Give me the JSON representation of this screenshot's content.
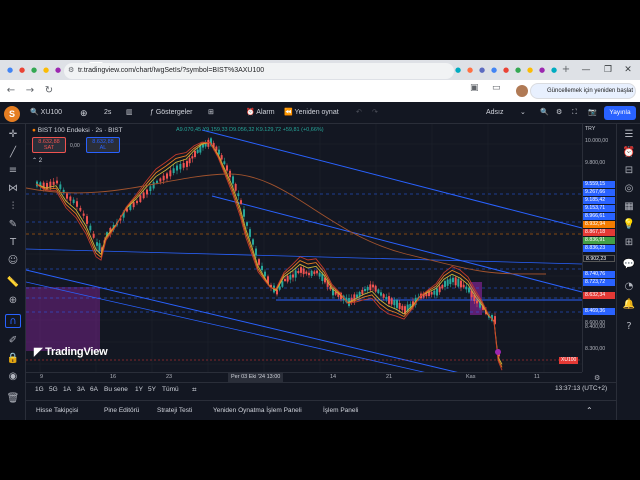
{
  "browser": {
    "tab_icons": [
      "●",
      "●",
      "●",
      "●",
      "●",
      "●",
      "●",
      "×",
      "●",
      "●",
      "●",
      "●",
      "●",
      "●",
      "●",
      "●",
      "●",
      "●",
      "●",
      "●",
      "●",
      "●",
      "●",
      "●",
      "●",
      "●",
      "●",
      "●",
      "●",
      "●",
      "●",
      "●",
      "●",
      "●",
      "●",
      "●",
      "●",
      "●",
      "●",
      "●",
      "●",
      "●",
      "●",
      "●",
      "●",
      "●"
    ],
    "new_tab": "+",
    "minimize": "—",
    "maximize": "❐",
    "close": "✕",
    "url": "tr.tradingview.com/chart/IwgSetIs/?symbol=BIST%3AXU100",
    "relaunch_label": "Güncellemek için yeniden başlat"
  },
  "header": {
    "symbol": "XU100",
    "interval": "2s",
    "indicators": "Göstergeler",
    "alarm": "Alarm",
    "replay": "Yeniden oynat",
    "untitled": "Adsız",
    "publish": "Yayınla",
    "logo_letter": "S"
  },
  "legend": {
    "title": "BIST 100 Endeksi · 2s · BIST",
    "ohlc": "A9.070,45  Y9.159,33  D9.056,32  K9.129,72  +59,81 (+0,66%)",
    "sell_price": "8.632,88",
    "sell_label": "SAT",
    "spread": "0,00",
    "buy_price": "8.632,88",
    "buy_label": "AL",
    "indicator_count": "2",
    "currency": "TRY",
    "watermark": "TradingView"
  },
  "price_scale": {
    "labels": [
      "10.000,00",
      "9.800,00",
      "9.600,00",
      "8.600,00",
      "8.400,00",
      "8.300,00"
    ],
    "boxes": [
      {
        "text": "9.559,15",
        "color": "#2962ff"
      },
      {
        "text": "9.267,66",
        "color": "#2962ff"
      },
      {
        "text": "9.185,42",
        "color": "#2962ff"
      },
      {
        "text": "9.153,71",
        "color": "#2962ff"
      },
      {
        "text": "8.966,61",
        "color": "#2962ff"
      },
      {
        "text": "8.932,94",
        "color": "#f57c00"
      },
      {
        "text": "8.867,18",
        "color": "#e53935"
      },
      {
        "text": "8.836,91",
        "color": "#43a047"
      },
      {
        "text": "8.836,23",
        "color": "#2962ff"
      },
      {
        "text": "8.902,23",
        "color": "#131722"
      },
      {
        "text": "8.740,76",
        "color": "#2962ff"
      },
      {
        "text": "8.723,72",
        "color": "#2962ff"
      },
      {
        "text": "8.632,34",
        "color": "#e53935"
      },
      {
        "text": "8.469,36",
        "color": "#2962ff"
      }
    ],
    "symbol_tag": "XU100"
  },
  "time_scale": {
    "labels": [
      "9",
      "16",
      "23",
      "14",
      "21",
      "Kas",
      "11"
    ],
    "crosshair": "Per 03 Eki '24   13:00"
  },
  "range_bar": {
    "ranges": [
      "1G",
      "5G",
      "1A",
      "3A",
      "6A",
      "Bu sene",
      "1Y",
      "5Y",
      "Tümü"
    ],
    "clock": "13:37:13 (UTC+2)"
  },
  "bottom_tabs": [
    "Hisse Takipçisi",
    "Pine Editörü",
    "Strateji Testi",
    "Yeniden Oynatma İşlem Paneli",
    "İşlem Paneli"
  ],
  "colors": {
    "up": "#26a69a",
    "down": "#ef5350",
    "channel": "#2962ff",
    "bg": "#131722",
    "ma_orange": "#e67e22",
    "ma_yellow": "#c9b43a",
    "ma_red": "#c0392b"
  }
}
